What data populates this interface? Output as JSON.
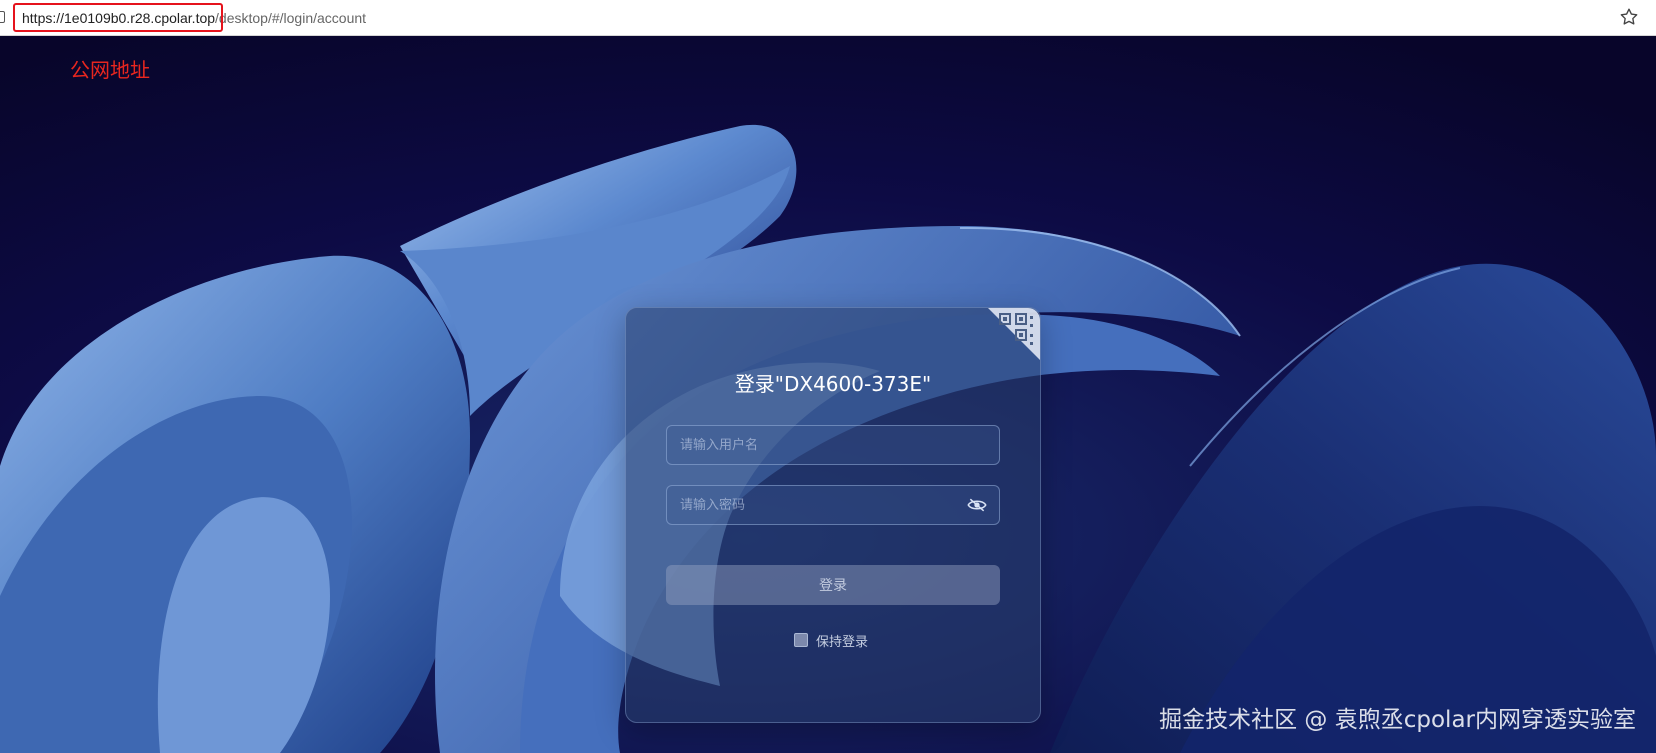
{
  "browser": {
    "url_host": "https://1e0109b0.r28.cpolar.top",
    "url_path": "/desktop/#/login/account",
    "star_icon": "bookmark-star-icon",
    "lock_icon": "site-info-icon"
  },
  "annotation": {
    "public_address_label": "公网地址",
    "highlight_color": "#e5131c"
  },
  "login": {
    "title": "登录\"DX4600-373E\"",
    "username_placeholder": "请输入用户名",
    "username_value": "",
    "password_placeholder": "请输入密码",
    "password_value": "",
    "password_toggle_icon": "eye-hidden-icon",
    "qr_icon": "qr-code-icon",
    "submit_label": "登录",
    "keep_login_label": "保持登录",
    "keep_login_checked": false
  },
  "watermark": {
    "text": "掘金技术社区 @ 袁煦丞cpolar内网穿透实验室"
  },
  "colors": {
    "background_dark": "#0a0630",
    "wallpaper_blue": "#4a7cc6",
    "annotation_red": "#e8261f"
  }
}
